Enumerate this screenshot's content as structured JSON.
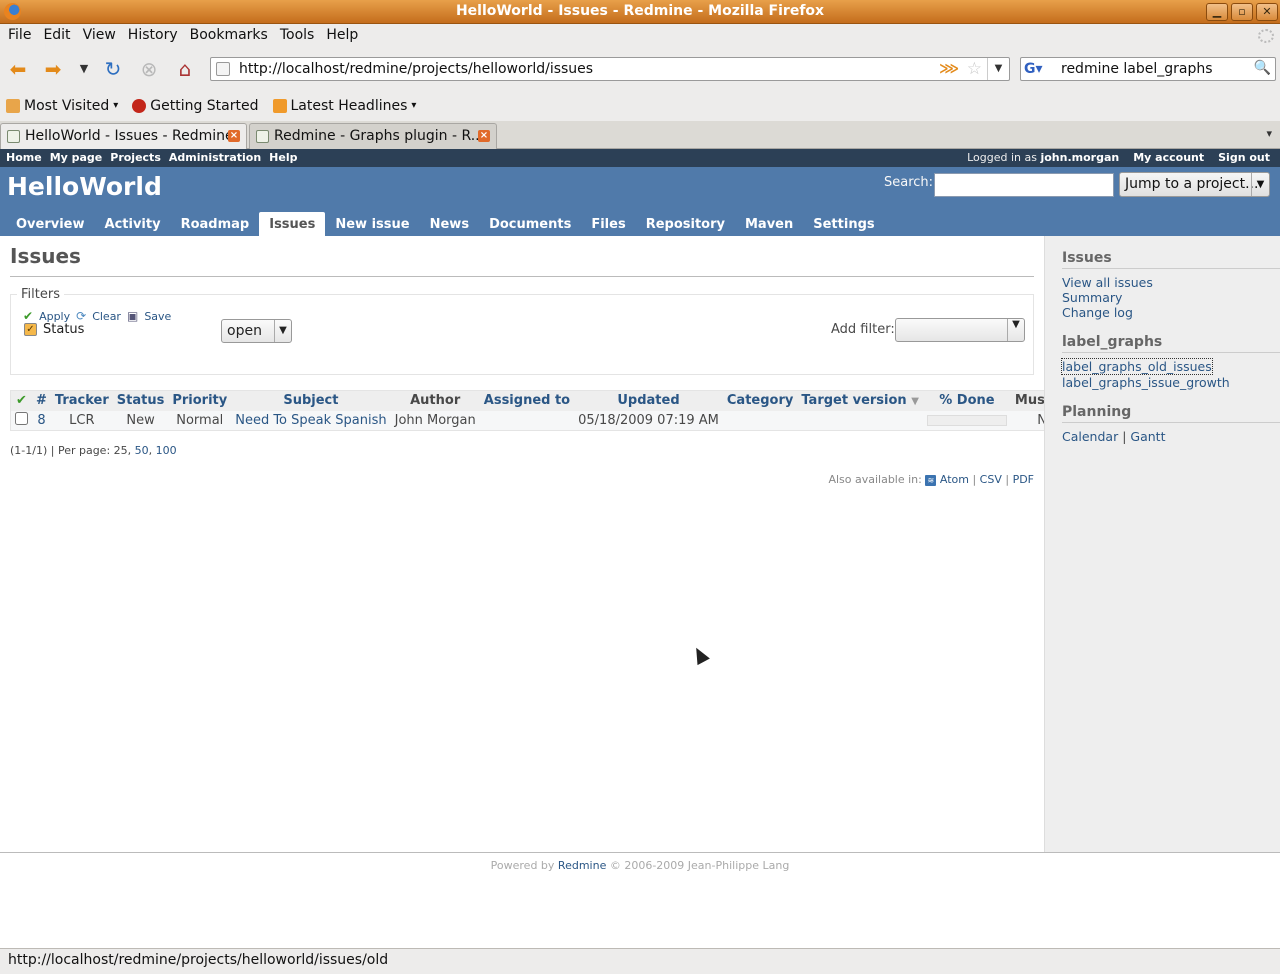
{
  "window": {
    "title": "HelloWorld - Issues - Redmine - Mozilla Firefox"
  },
  "menu": [
    "File",
    "Edit",
    "View",
    "History",
    "Bookmarks",
    "Tools",
    "Help"
  ],
  "navigation": {
    "url": "http://localhost/redmine/projects/helloworld/issues",
    "search_query": "redmine  label_graphs"
  },
  "bookmarks": [
    "Most Visited",
    "Getting Started",
    "Latest Headlines"
  ],
  "tabs": [
    {
      "label": "HelloWorld - Issues - Redmine",
      "active": true
    },
    {
      "label": "Redmine - Graphs plugin - R...",
      "active": false
    }
  ],
  "redmine": {
    "top_menu": [
      "Home",
      "My page",
      "Projects",
      "Administration",
      "Help"
    ],
    "logged_in_prefix": "Logged in as",
    "user": "john.morgan",
    "account_links": [
      "My account",
      "Sign out"
    ],
    "project_title": "HelloWorld",
    "search_label": "Search:",
    "jump_label": "Jump to a project...",
    "main_menu": [
      "Overview",
      "Activity",
      "Roadmap",
      "Issues",
      "New issue",
      "News",
      "Documents",
      "Files",
      "Repository",
      "Maven",
      "Settings"
    ],
    "selected_tab": "Issues"
  },
  "content": {
    "heading": "Issues",
    "filters": {
      "legend": "Filters",
      "status_label": "Status",
      "status_value": "open",
      "add_filter_label": "Add filter:",
      "apply": "Apply",
      "clear": "Clear",
      "save": "Save"
    },
    "table": {
      "headers": [
        "#",
        "Tracker",
        "Status",
        "Priority",
        "Subject",
        "Author",
        "Assigned to",
        "Updated",
        "Category",
        "Target version",
        "% Done",
        "Must Fix"
      ],
      "rows": [
        {
          "id": "8",
          "tracker": "LCR",
          "status": "New",
          "priority": "Normal",
          "subject": "Need To Speak Spanish",
          "author": "John Morgan",
          "assigned_to": "",
          "updated": "05/18/2009 07:19 AM",
          "category": "",
          "target_version": "",
          "done_percent": 0,
          "must_fix": "No"
        }
      ]
    },
    "pagination": {
      "summary": "(1-1/1) | Per page: 25,",
      "options": [
        "50",
        "100"
      ]
    },
    "formats": {
      "label": "Also available in:",
      "links": [
        "Atom",
        "CSV",
        "PDF"
      ]
    }
  },
  "sidebar": {
    "issues_heading": "Issues",
    "issues_links": [
      "View all issues",
      "Summary",
      "Change log"
    ],
    "graphs_heading": "label_graphs",
    "graphs_links": [
      "label_graphs_old_issues",
      "label_graphs_issue_growth"
    ],
    "planning_heading": "Planning",
    "planning_links": [
      "Calendar",
      "Gantt"
    ],
    "planning_sep": "|"
  },
  "footer": {
    "prefix": "Powered by",
    "link": "Redmine",
    "suffix": "© 2006-2009 Jean-Philippe Lang"
  },
  "statusbar": {
    "text": "http://localhost/redmine/projects/helloworld/issues/old"
  },
  "colors": {
    "header_bg": "#507aaa",
    "top_menu_bg": "#2c4056",
    "link": "#2a5685",
    "titlebar": "#d9822b"
  }
}
